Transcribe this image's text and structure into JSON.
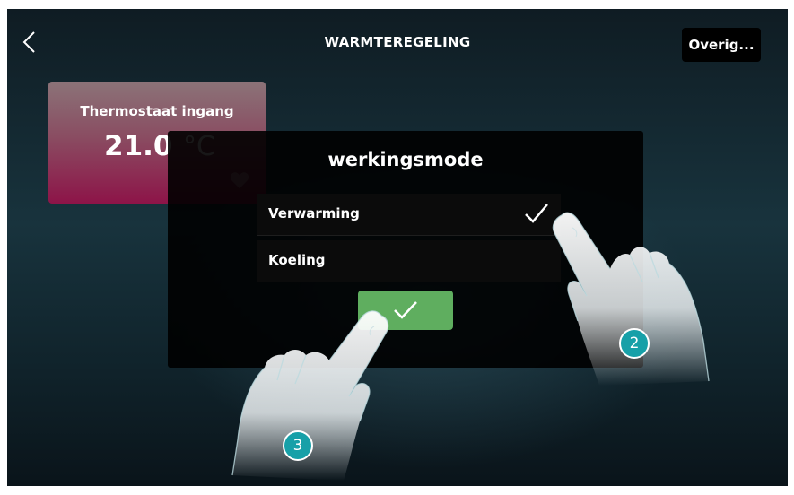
{
  "header": {
    "title": "WARMTEREGELING",
    "more_label": "Overig..."
  },
  "thermostat_tile": {
    "name": "Thermostaat ingang",
    "temperature": "21.0",
    "unit": "°C",
    "favorite_icon": "heart-icon"
  },
  "dialog": {
    "title": "werkingsmode",
    "options": [
      {
        "label": "Verwarming",
        "selected": true
      },
      {
        "label": "Koeling",
        "selected": false
      }
    ],
    "confirm_icon": "check-icon"
  },
  "annotations": {
    "step_2": "2",
    "step_3": "3"
  },
  "colors": {
    "confirm_green": "#5fae5f",
    "badge_teal": "#17a0a8",
    "tile_magenta": "#8d1448"
  }
}
